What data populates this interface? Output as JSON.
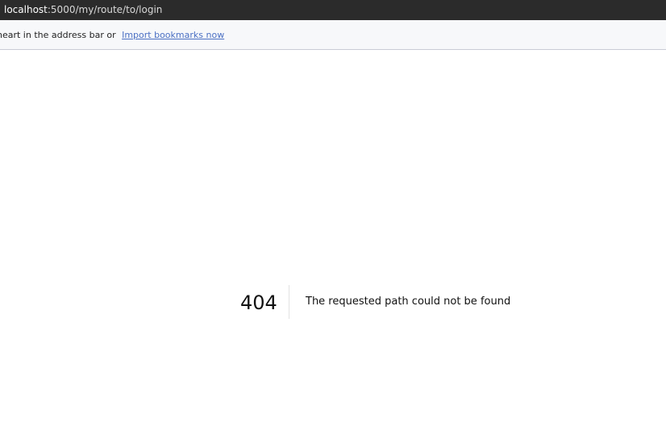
{
  "address_bar": {
    "host": "localhost",
    "path": ":5000/my/route/to/login"
  },
  "bookmarks_bar": {
    "hint_text": "heart in the address bar or ",
    "import_link": "Import bookmarks now"
  },
  "error": {
    "code": "404",
    "message": "The requested path could not be found"
  }
}
